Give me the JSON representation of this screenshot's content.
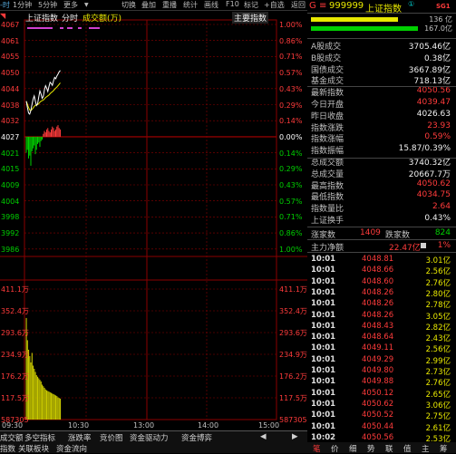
{
  "toolbar": {
    "left_fragment": "-时",
    "items": [
      "1分钟",
      "5分钟",
      "更多",
      "切换",
      "叠加",
      "重播",
      "统计",
      "画线",
      "F10",
      "标记",
      "+自选",
      "返回"
    ]
  },
  "chart_header": {
    "index_name": "上证指数",
    "mode": "分时",
    "indicator": "成交额(万)",
    "main_index_btn": "主要指数"
  },
  "price_axis": {
    "left": [
      "4067",
      "4061",
      "4055",
      "4050",
      "4044",
      "4038",
      "4032",
      "4027",
      "4021",
      "4015",
      "4009",
      "4004",
      "3998",
      "3992",
      "3986"
    ],
    "right": [
      "1.00%",
      "0.86%",
      "0.71%",
      "0.57%",
      "0.43%",
      "0.29%",
      "0.14%",
      "0.00%",
      "0.14%",
      "0.29%",
      "0.43%",
      "0.57%",
      "0.71%",
      "0.86%",
      "1.00%"
    ]
  },
  "volume_axis": {
    "left": [
      "411.1万",
      "352.4万",
      "293.6万",
      "234.9万",
      "176.2万",
      "117.5万",
      "587305"
    ],
    "right": [
      "411.1万",
      "352.4万",
      "293.6万",
      "234.9万",
      "176.2万",
      "117.5万",
      "587305"
    ]
  },
  "time_axis": [
    "09:30",
    "10:30",
    "13:00",
    "14:00",
    "15:00"
  ],
  "bottom_tabs": [
    "成交额",
    "多空指标",
    "涨跌率",
    "竞价图",
    "资金驱动力",
    "资金博弈"
  ],
  "bottom_tabs2": [
    "指数",
    "关联板块",
    "资金流向"
  ],
  "quote_header": {
    "prefix": "G",
    "code": "999999",
    "name": "上证指数",
    "badge": "SG1"
  },
  "order_bars": {
    "top_value": "136 亿",
    "bottom_value": "167.0亿"
  },
  "stats": [
    {
      "label": "A股成交",
      "value": "3705.46亿",
      "color": "white"
    },
    {
      "label": "B股成交",
      "value": "0.38亿",
      "color": "white"
    },
    {
      "label": "国债成交",
      "value": "3667.89亿",
      "color": "white"
    },
    {
      "label": "基金成交",
      "value": "718.13亿",
      "color": "white"
    },
    {
      "label": "最新指数",
      "value": "4050.56",
      "color": "red"
    },
    {
      "label": "今日开盘",
      "value": "4039.47",
      "color": "red"
    },
    {
      "label": "昨日收盘",
      "value": "4026.63",
      "color": "white"
    },
    {
      "label": "指数涨跌",
      "value": "23.93",
      "color": "red"
    },
    {
      "label": "指数涨幅",
      "value": "0.59%",
      "color": "red"
    },
    {
      "label": "指数振幅",
      "value": "15.87/0.39%",
      "color": "white"
    },
    {
      "label": "总成交额",
      "value": "3740.32亿",
      "color": "white"
    },
    {
      "label": "总成交量",
      "value": "20667.7万",
      "color": "white"
    },
    {
      "label": "最高指数",
      "value": "4050.62",
      "color": "red"
    },
    {
      "label": "最低指数",
      "value": "4034.75",
      "color": "red"
    },
    {
      "label": "指数量比",
      "value": "2.64",
      "color": "red"
    },
    {
      "label": "上证换手",
      "value": "0.43%",
      "color": "white"
    }
  ],
  "updown": {
    "up_label": "涨家数",
    "up_value": "1409",
    "down_label": "跌家数",
    "down_value": "824"
  },
  "net_flow": {
    "label": "主力净额",
    "value": "22.47亿",
    "pct": "1%"
  },
  "ticks": [
    {
      "time": "10:01",
      "price": "4048.81",
      "amount": "3.01亿"
    },
    {
      "time": "10:01",
      "price": "4048.66",
      "amount": "2.56亿"
    },
    {
      "time": "10:01",
      "price": "4048.60",
      "amount": "2.76亿"
    },
    {
      "time": "10:01",
      "price": "4048.26",
      "amount": "2.80亿"
    },
    {
      "time": "10:01",
      "price": "4048.26",
      "amount": "2.78亿"
    },
    {
      "time": "10:01",
      "price": "4048.26",
      "amount": "3.05亿"
    },
    {
      "time": "10:01",
      "price": "4048.43",
      "amount": "2.82亿"
    },
    {
      "time": "10:01",
      "price": "4048.64",
      "amount": "2.43亿"
    },
    {
      "time": "10:01",
      "price": "4049.11",
      "amount": "2.56亿"
    },
    {
      "time": "10:01",
      "price": "4049.29",
      "amount": "2.99亿"
    },
    {
      "time": "10:01",
      "price": "4049.80",
      "amount": "2.73亿"
    },
    {
      "time": "10:01",
      "price": "4049.88",
      "amount": "2.76亿"
    },
    {
      "time": "10:01",
      "price": "4050.12",
      "amount": "2.65亿"
    },
    {
      "time": "10:01",
      "price": "4050.62",
      "amount": "3.06亿"
    },
    {
      "time": "10:01",
      "price": "4050.52",
      "amount": "2.75亿"
    },
    {
      "time": "10:01",
      "price": "4050.44",
      "amount": "2.61亿"
    },
    {
      "time": "10:02",
      "price": "4050.56",
      "amount": "2.53亿"
    }
  ],
  "rp_bottom": [
    "笔",
    "价",
    "细",
    "势",
    "联",
    "值",
    "主",
    "筹"
  ],
  "colors": {
    "up": "#ff3b3b",
    "down": "#00d000",
    "grid": "#8b0000",
    "price_line": "#ffffff",
    "avg_line": "#e8e800",
    "volume": "#c8c800"
  }
}
